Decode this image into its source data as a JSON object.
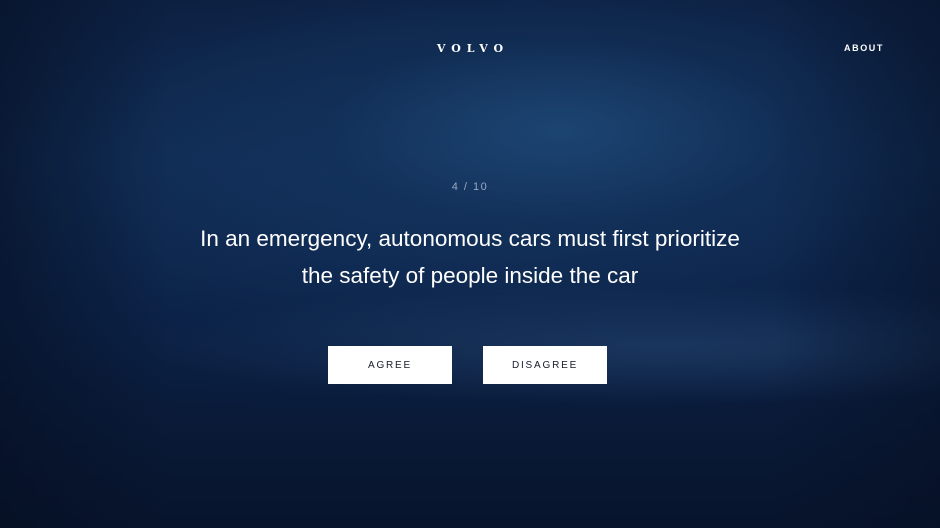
{
  "header": {
    "logo_text": "VOLVO",
    "about_label": "ABOUT"
  },
  "survey": {
    "counter": "4 / 10",
    "current_question": 4,
    "total_questions": 10,
    "question_line1": "In an emergency, autonomous cars must first prioritize",
    "question_line2": "the safety of people inside the car"
  },
  "actions": {
    "agree_label": "AGREE",
    "disagree_label": "DISAGREE"
  },
  "colors": {
    "background": "#0b2146",
    "text": "#ffffff",
    "counter_text": "#9aa9c2",
    "button_background": "#ffffff",
    "button_text": "#141c2a"
  }
}
